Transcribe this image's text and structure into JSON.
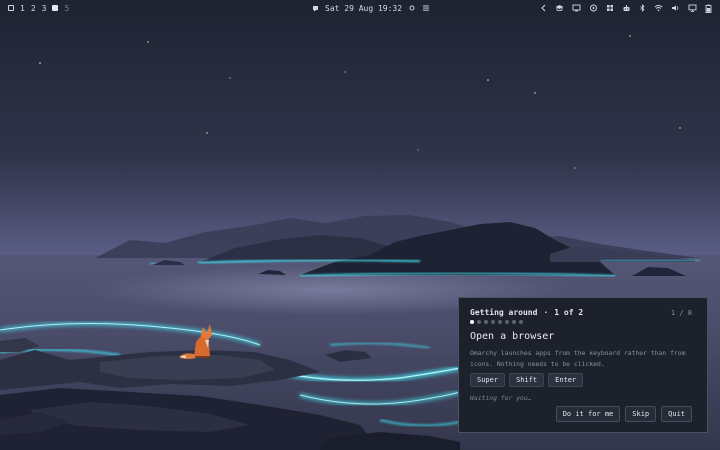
{
  "topbar": {
    "workspaces": [
      "1",
      "2",
      "3",
      "5"
    ],
    "active_workspace": "4",
    "clock": "Sat 29 Aug 19:32",
    "tray_icons": [
      "chevron-left-icon",
      "graduation-cap-icon",
      "monitor-icon",
      "gamepad-icon",
      "grid-icon",
      "robot-icon",
      "bluetooth-icon",
      "wifi-icon",
      "volume-icon",
      "display-icon",
      "battery-icon"
    ]
  },
  "tutorial": {
    "section": "Getting around",
    "separator": "·",
    "progress_label": "1 of 2",
    "counter": "1 / 8",
    "dots_total": 8,
    "dots_active": 1,
    "title": "Open a browser",
    "description": "Omarchy launches apps from the keyboard rather than from icons. Nothing needs to be clicked.",
    "keys": [
      "Super",
      "Shift",
      "Enter"
    ],
    "status": "Waiting for you…",
    "actions": {
      "do_it": "Do it for me",
      "skip": "Skip",
      "quit": "Quit"
    }
  },
  "colors": {
    "glow": "#3ff0ff",
    "sky_top": "#1f2534",
    "sky_bottom": "#5c5f86",
    "panel_bg": "#1c212c"
  }
}
